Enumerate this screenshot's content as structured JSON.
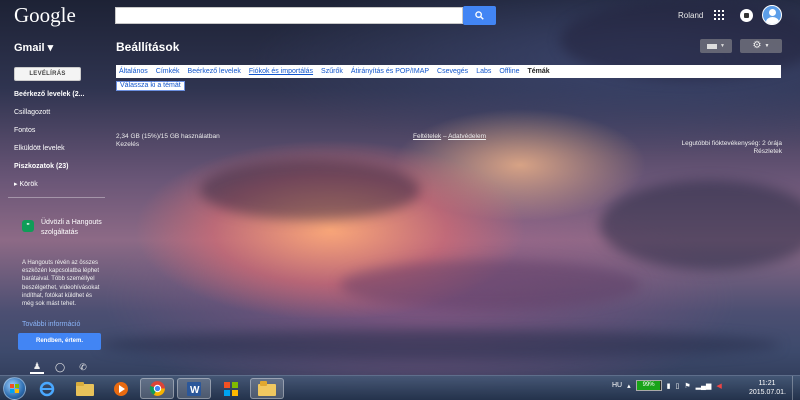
{
  "header": {
    "logo": "Google",
    "search_placeholder": "",
    "user_name": "Roland"
  },
  "gmail": {
    "label": "Gmail ▾",
    "page_title": "Beállítások"
  },
  "sidebar": {
    "compose_label": "LEVÉLÍRÁS",
    "items": [
      {
        "label": "Beérkező levelek (2...",
        "bold": true
      },
      {
        "label": "Csillagozott",
        "bold": false
      },
      {
        "label": "Fontos",
        "bold": false
      },
      {
        "label": "Elküldött levelek",
        "bold": false
      },
      {
        "label": "Piszkozatok (23)",
        "bold": true
      },
      {
        "label": "▸ Körök",
        "bold": false
      }
    ],
    "hangouts": {
      "title": "Üdvözli a Hangouts szolgáltatás",
      "text": "A Hangouts révén az összes eszközén kapcsolatba léphet barátaival. Több személlyel beszélgethet, videohívásokat indíthat, fotókat küldhet és még sok mást tehet.",
      "link": "További információ",
      "button": "Rendben, értem."
    }
  },
  "settings": {
    "tabs": [
      {
        "label": "Általános",
        "active": false,
        "underline": false
      },
      {
        "label": "Címkék",
        "active": false,
        "underline": false
      },
      {
        "label": "Beérkező levelek",
        "active": false,
        "underline": false
      },
      {
        "label": "Fiókok és importálás",
        "active": false,
        "underline": true
      },
      {
        "label": "Szűrők",
        "active": false,
        "underline": false
      },
      {
        "label": "Átirányítás és POP/IMAP",
        "active": false,
        "underline": false
      },
      {
        "label": "Csevegés",
        "active": false,
        "underline": false
      },
      {
        "label": "Labs",
        "active": false,
        "underline": false
      },
      {
        "label": "Offline",
        "active": false,
        "underline": false
      },
      {
        "label": "Témák",
        "active": true,
        "underline": false
      }
    ],
    "theme_link": "Válassza ki a témát"
  },
  "footer": {
    "storage": "2,34 GB (15%)/15 GB használatban",
    "manage": "Kezelés",
    "terms": "Feltételek",
    "sep": " – ",
    "privacy": "Adatvédelem",
    "activity_line1": "Legutóbbi fióktevékenység: 2 órája",
    "activity_line2": "Részletek"
  },
  "taskbar": {
    "apps": [
      "windows-explorer",
      "internet-explorer",
      "file-explorer",
      "media-player",
      "chrome",
      "word",
      "calculator",
      "folder"
    ],
    "tray_language": "HU",
    "battery_percent": 99,
    "battery_label": "99%",
    "clock_time": "11:21",
    "clock_date": "2015.07.01."
  }
}
